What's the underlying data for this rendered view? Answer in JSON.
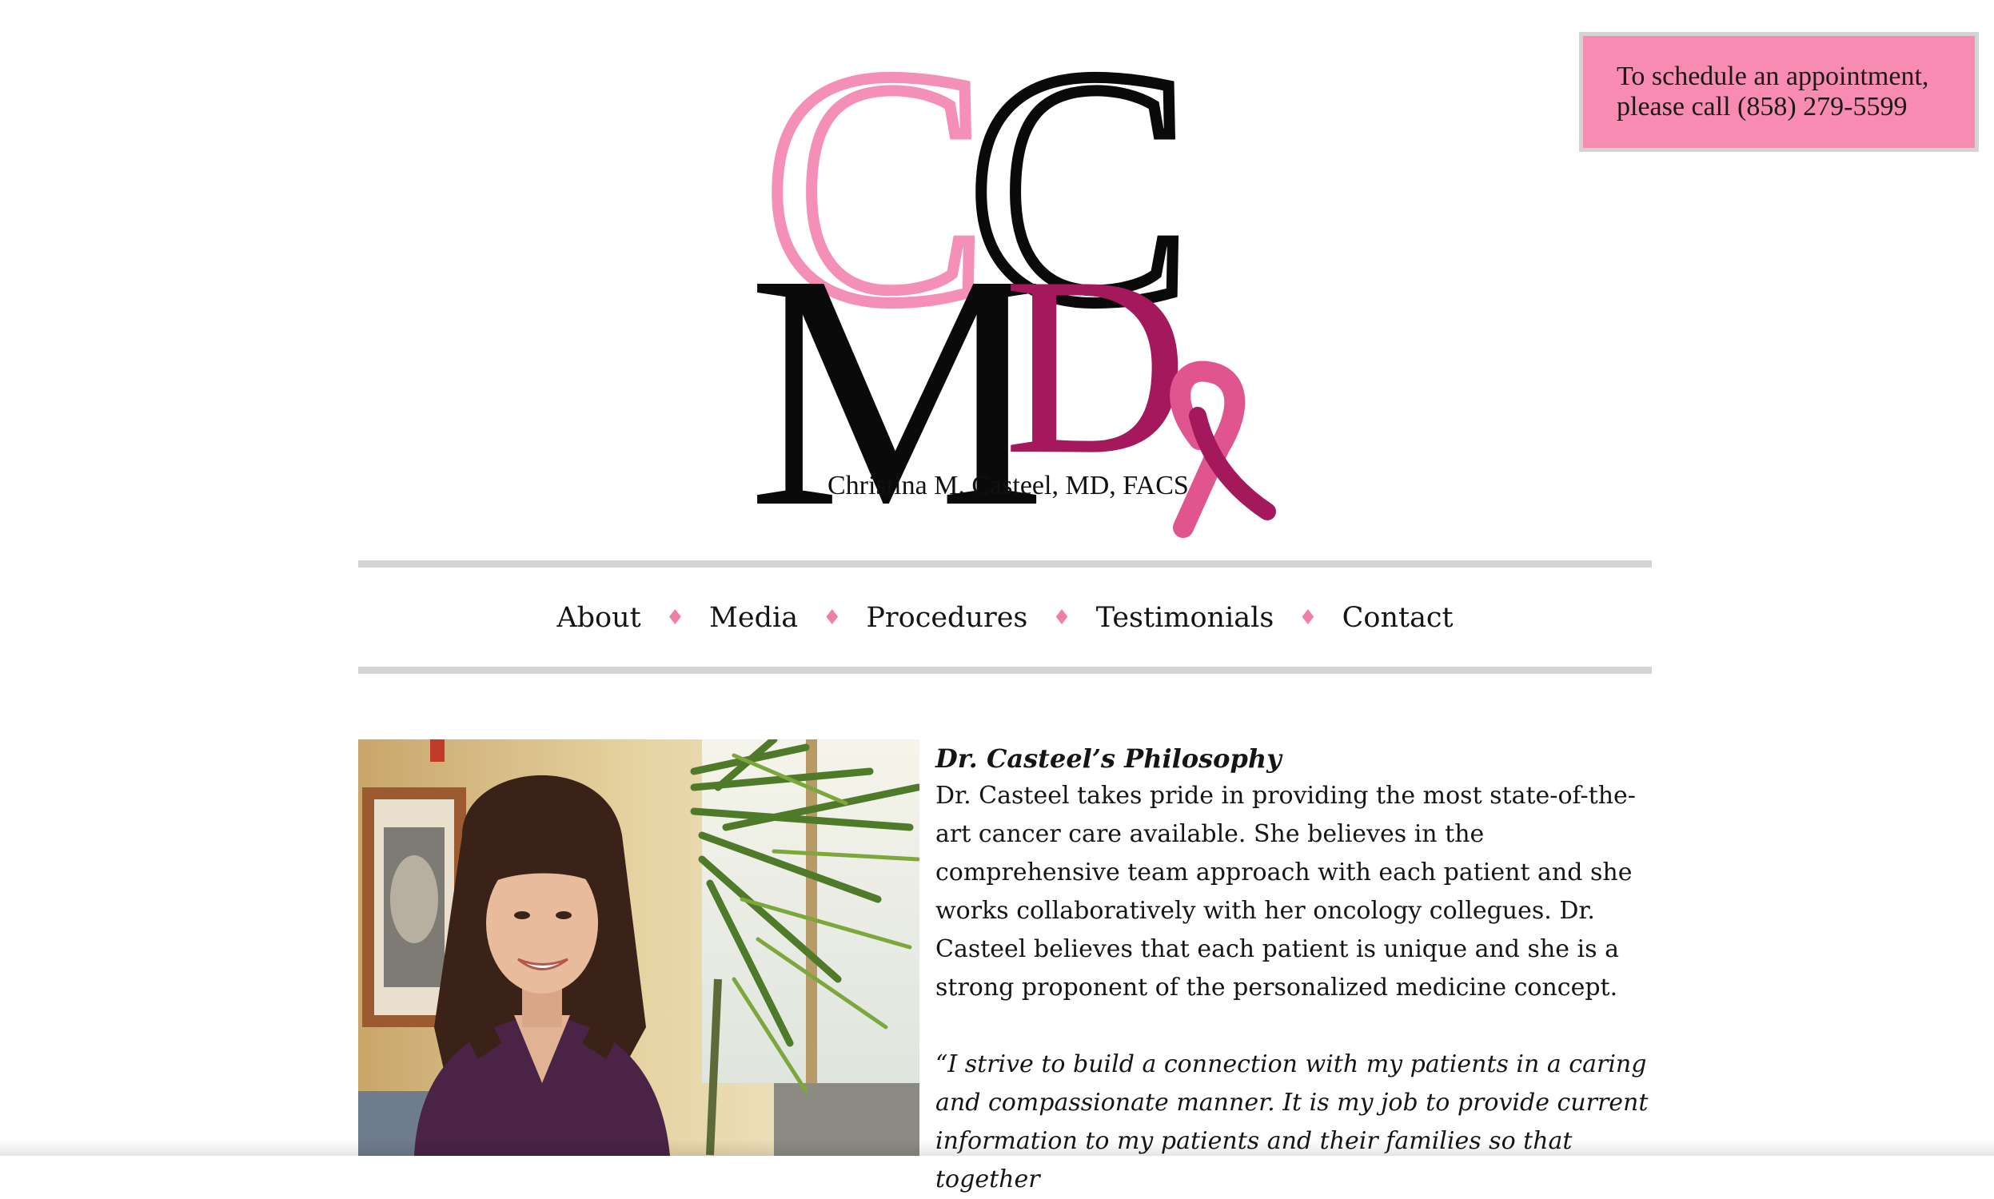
{
  "appointment": {
    "line1": "To schedule an appointment,",
    "line2": "please call (858) 279-5599"
  },
  "logo": {
    "monogram_c1": "C",
    "monogram_c2": "C",
    "monogram_m": "M",
    "monogram_d": "D",
    "name": "Christina M. Casteel, MD, FACS",
    "colors": {
      "pink": "#f48fb7",
      "black": "#0a0a0a",
      "magenta": "#a3195b",
      "ribbon": "#e0548f"
    }
  },
  "nav": {
    "items": [
      {
        "label": "About"
      },
      {
        "label": "Media"
      },
      {
        "label": "Procedures"
      },
      {
        "label": "Testimonials"
      },
      {
        "label": "Contact"
      }
    ],
    "separator": "♦",
    "separator_color": "#ef7fa9"
  },
  "content": {
    "heading": "Dr. Casteel’s Philosophy",
    "paragraph": "Dr. Casteel takes pride in providing the most state-of-the-art cancer care available. She believes in the comprehensive team approach with each patient and she works collaboratively with her oncology collegues. Dr. Casteel believes that each patient is unique and she is a strong proponent of the personalized medicine concept.",
    "quote": "“I strive to build a connection with my patients in a caring and compassionate manner. It is my job to provide current information to my patients and their families so that together"
  },
  "photo": {
    "subject": "portrait-photo"
  },
  "colors": {
    "accent_pink": "#f78bb1",
    "rule_gray": "#d4d4d4"
  }
}
